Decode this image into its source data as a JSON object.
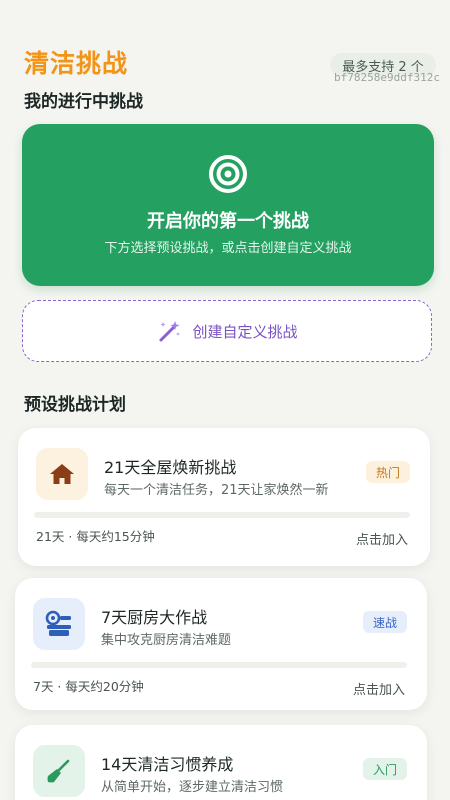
{
  "header": {
    "title": "清洁挑战",
    "limit_badge": "最多支持 2 个",
    "hash": "bf78258e9ddf312c"
  },
  "active_section": {
    "title": "我的进行中挑战"
  },
  "hero": {
    "icon": "target-icon",
    "title": "开启你的第一个挑战",
    "subtitle": "下方选择预设挑战，或点击创建自定义挑战"
  },
  "create_button": {
    "icon": "magic-wand-icon",
    "label": "创建自定义挑战"
  },
  "preset_section": {
    "title": "预设挑战计划"
  },
  "plans": [
    {
      "icon": "house-icon",
      "title": "21天全屋焕新挑战",
      "description": "每天一个清洁任务，21天让家焕然一新",
      "tag": "热门",
      "progress": 0,
      "meta": "21天 · 每天约15分钟",
      "action": "点击加入"
    },
    {
      "icon": "kitchen-icon",
      "title": "7天厨房大作战",
      "description": "集中攻克厨房清洁难题",
      "tag": "速战",
      "progress": 0,
      "meta": "7天 · 每天约20分钟",
      "action": "点击加入"
    },
    {
      "icon": "broom-icon",
      "title": "14天清洁习惯养成",
      "description": "从简单开始，逐步建立清洁习惯",
      "tag": "入门"
    }
  ],
  "colors": {
    "accent_orange": "#f39417",
    "primary_green": "#24a061",
    "purple": "#7a52c4"
  }
}
